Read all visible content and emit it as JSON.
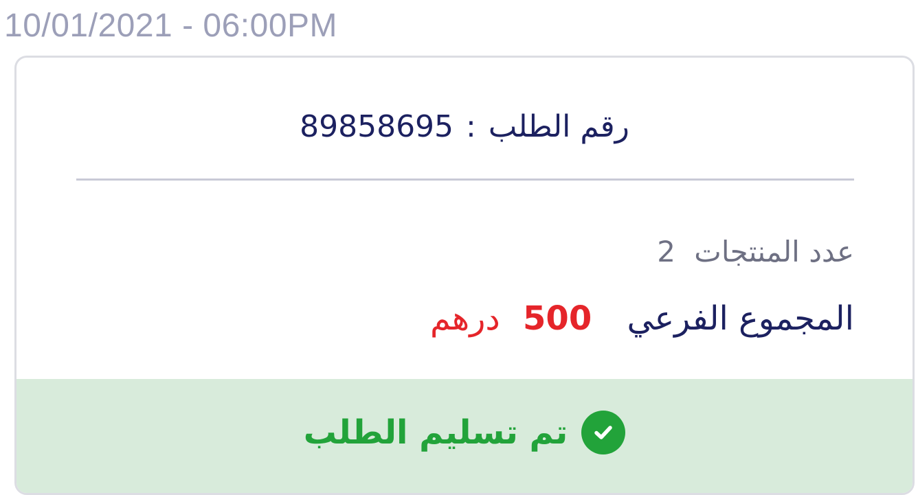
{
  "order": {
    "datetime": "10/01/2021 - 06:00PM",
    "number_label": "رقم الطلب",
    "separator": ":",
    "number": "89858695",
    "count_label": "عدد المنتجات",
    "count": "2",
    "subtotal_label": "المجموع الفرعي",
    "subtotal_amount": "500",
    "currency": "درهم",
    "status_text": "تم تسليم الطلب",
    "status_icon": "check-circle-icon"
  },
  "colors": {
    "navy": "#1c2160",
    "price_red": "#e5252a",
    "status_green": "#22a33a",
    "status_bg": "#d8ebdb",
    "muted": "#9c9fb8"
  }
}
